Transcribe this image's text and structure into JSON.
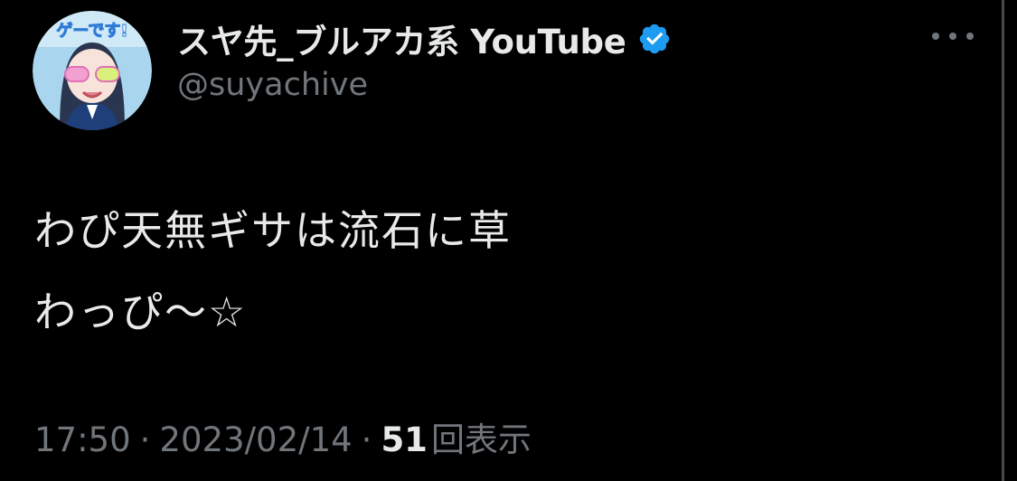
{
  "author": {
    "display_name": "スヤ先_ブルアカ系 YouTube",
    "handle": "@suyachive",
    "verified": true,
    "avatar_caption": "ゲーです!"
  },
  "tweet": {
    "lines": [
      "わぴ天無ギサは流石に草",
      "わっぴ〜☆"
    ]
  },
  "meta": {
    "time": "17:50",
    "separator": "·",
    "date": "2023/02/14",
    "views_count": "51",
    "views_label": "回表示"
  },
  "icons": {
    "verified": "verified-badge-icon",
    "more": "more-options-icon"
  },
  "colors": {
    "background": "#000000",
    "text": "#e7e9ea",
    "muted": "#71767b",
    "verified": "#1d9bf0"
  }
}
